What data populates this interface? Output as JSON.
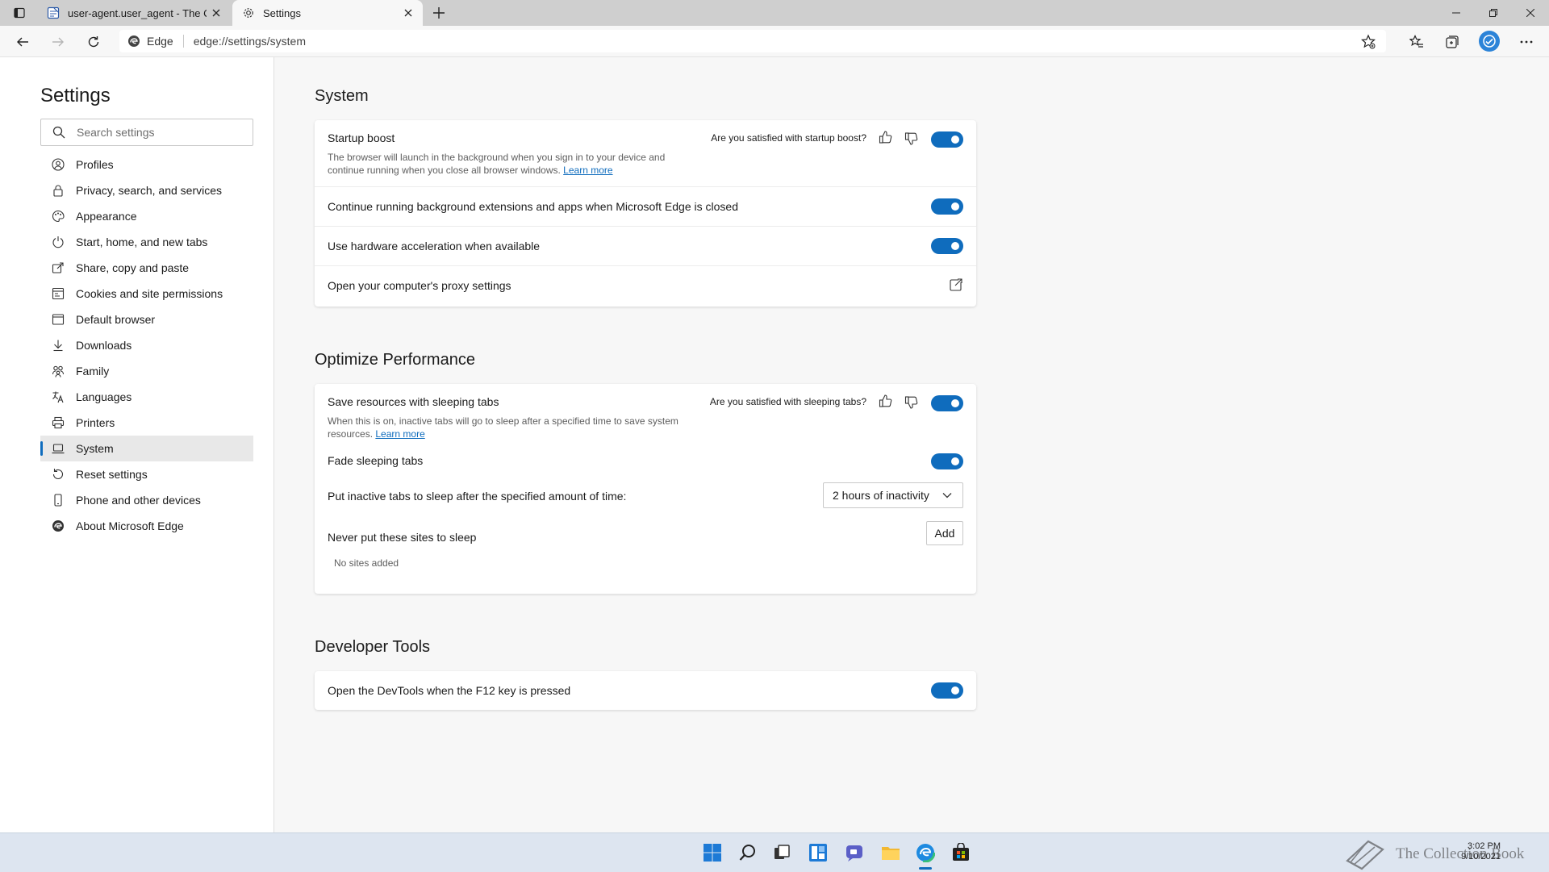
{
  "browser": {
    "tabs": [
      {
        "title": "user-agent.user_agent - The Coll",
        "active": false,
        "favicon": "document-page-icon"
      },
      {
        "title": "Settings",
        "active": true,
        "favicon": "gear-icon"
      }
    ],
    "address": {
      "prefix": "Edge",
      "url": "edge://settings/system"
    }
  },
  "sidebar": {
    "title": "Settings",
    "search_placeholder": "Search settings",
    "items": [
      {
        "label": "Profiles",
        "icon": "profile-icon"
      },
      {
        "label": "Privacy, search, and services",
        "icon": "lock-icon"
      },
      {
        "label": "Appearance",
        "icon": "palette-icon"
      },
      {
        "label": "Start, home, and new tabs",
        "icon": "power-icon"
      },
      {
        "label": "Share, copy and paste",
        "icon": "share-icon"
      },
      {
        "label": "Cookies and site permissions",
        "icon": "site-permissions-icon"
      },
      {
        "label": "Default browser",
        "icon": "browser-icon"
      },
      {
        "label": "Downloads",
        "icon": "download-icon"
      },
      {
        "label": "Family",
        "icon": "family-icon"
      },
      {
        "label": "Languages",
        "icon": "languages-icon"
      },
      {
        "label": "Printers",
        "icon": "printer-icon"
      },
      {
        "label": "System",
        "icon": "laptop-icon",
        "active": true
      },
      {
        "label": "Reset settings",
        "icon": "reset-icon"
      },
      {
        "label": "Phone and other devices",
        "icon": "phone-icon"
      },
      {
        "label": "About Microsoft Edge",
        "icon": "edge-icon"
      }
    ]
  },
  "system": {
    "title": "System",
    "startup_boost": {
      "label": "Startup boost",
      "description": "The browser will launch in the background when you sign in to your device and continue running when you close all browser windows.",
      "learn_more": "Learn more",
      "feedback": "Are you satisfied with startup boost?",
      "enabled": true
    },
    "background_extensions": {
      "label": "Continue running background extensions and apps when Microsoft Edge is closed",
      "enabled": true
    },
    "hardware_acceleration": {
      "label": "Use hardware acceleration when available",
      "enabled": true
    },
    "proxy": {
      "label": "Open your computer's proxy settings"
    }
  },
  "performance": {
    "title": "Optimize Performance",
    "sleeping_tabs": {
      "label": "Save resources with sleeping tabs",
      "description": "When this is on, inactive tabs will go to sleep after a specified time to save system resources.",
      "learn_more": "Learn more",
      "feedback": "Are you satisfied with sleeping tabs?",
      "enabled": true
    },
    "fade_sleeping": {
      "label": "Fade sleeping tabs",
      "enabled": true
    },
    "sleep_after": {
      "label": "Put inactive tabs to sleep after the specified amount of time:",
      "value": "2 hours of inactivity"
    },
    "never_sleep": {
      "label": "Never put these sites to sleep",
      "add_label": "Add",
      "empty_text": "No sites added"
    }
  },
  "devtools": {
    "title": "Developer Tools",
    "f12": {
      "label": "Open the DevTools when the F12 key is pressed",
      "enabled": true
    }
  },
  "taskbar": {
    "icons": [
      "start-icon",
      "search-icon",
      "task-view-icon",
      "widgets-icon",
      "chat-icon",
      "file-explorer-icon",
      "edge-icon",
      "store-icon"
    ],
    "watermark": "The Collection Book",
    "time": "3:02 PM",
    "date": "9/10/2021"
  },
  "colors": {
    "accent": "#0f6cbd",
    "taskbar": "#dde5f0"
  }
}
